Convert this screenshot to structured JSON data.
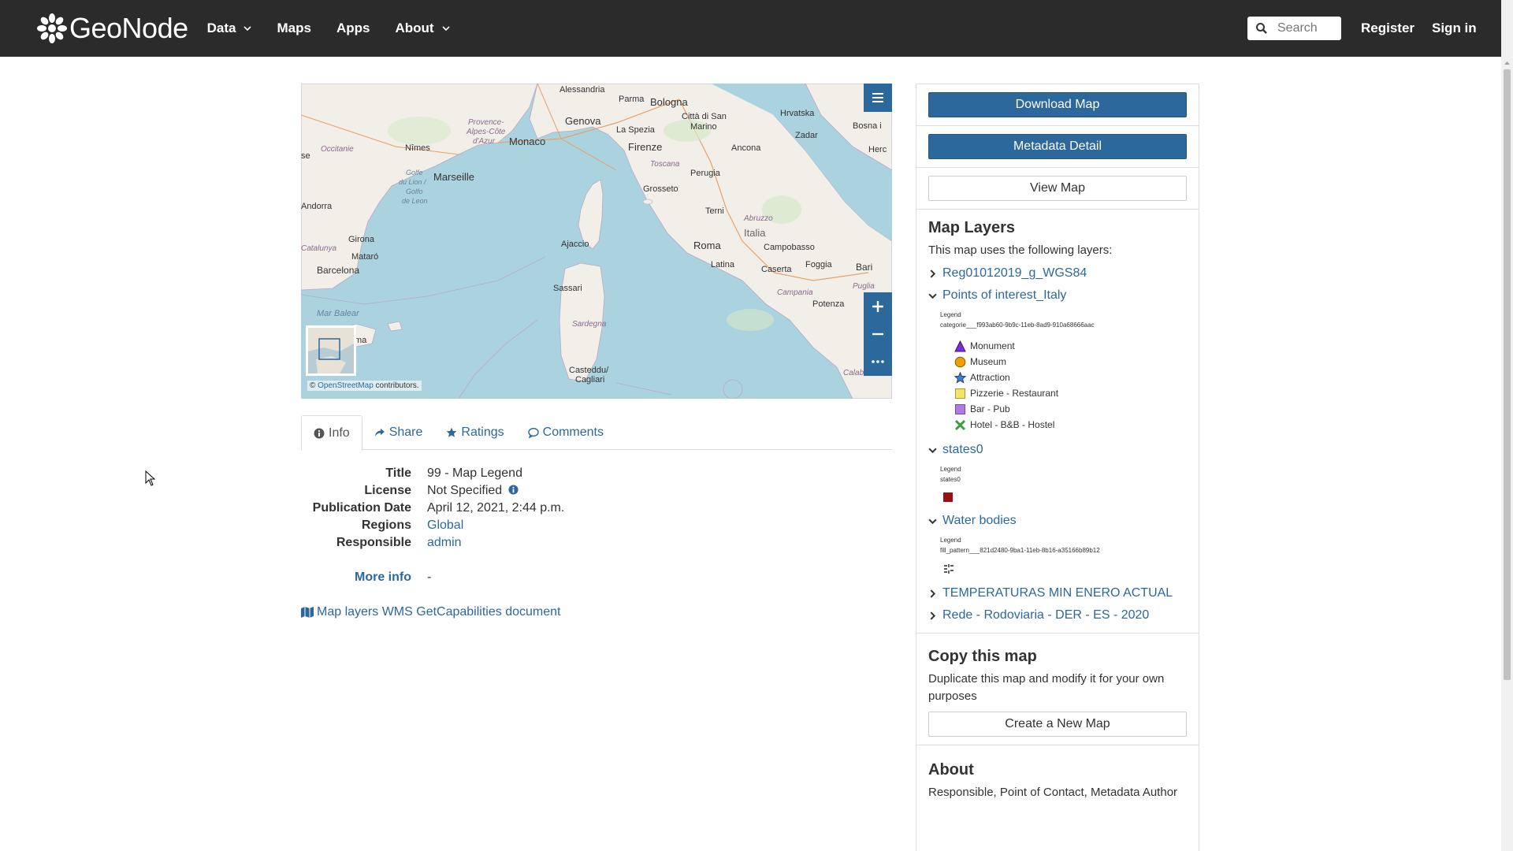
{
  "navbar": {
    "brand": "GeoNode",
    "links": [
      {
        "label": "Data",
        "dropdown": true
      },
      {
        "label": "Maps",
        "dropdown": false
      },
      {
        "label": "Apps",
        "dropdown": false
      },
      {
        "label": "About",
        "dropdown": true
      }
    ],
    "search_placeholder": "Search",
    "register": "Register",
    "signin": "Sign in"
  },
  "map": {
    "attribution_prefix": "©",
    "attribution_link": "OpenStreetMap",
    "attribution_suffix": "contributors.",
    "labels": {
      "alessandria": "Alessandria",
      "parma": "Parma",
      "bologna": "Bologna",
      "genova": "Genova",
      "sanmarino1": "Città di San",
      "sanmarino2": "Marino",
      "hrvatska": "Hrvatska",
      "bosna": "Bosna i",
      "zadar": "Zadar",
      "herc": "Herc",
      "provence1": "Provence-",
      "provence2": "Alpes-Côte",
      "provence3": "d'Azur",
      "monaco": "Monaco",
      "laspezia": "La Spezia",
      "firenze": "Firenze",
      "ancona": "Ancona",
      "nimes": "Nîmes",
      "occitanie": "Occitanie",
      "toscana": "Toscana",
      "perugia": "Perugia",
      "marseille": "Marseille",
      "golfe1": "Golfe",
      "golfe2": "du Lion /",
      "golfe3": "Golfo",
      "golfe4": "de Leon",
      "grosseto": "Grosseto",
      "andorra": "Andorra",
      "terni": "Terni",
      "abruzzo": "Abruzzo",
      "italia": "Italia",
      "girona": "Girona",
      "ajaccio": "Ajaccio",
      "roma": "Roma",
      "campobasso": "Campobasso",
      "catalunya": "Catalunya",
      "mataro": "Mataró",
      "foggia": "Foggia",
      "bari": "Bari",
      "barcelona": "Barcelona",
      "sassari": "Sassari",
      "latina": "Latina",
      "caserta": "Caserta",
      "campania": "Campania",
      "puglia": "Puglia",
      "sardegna": "Sardegna",
      "potenza": "Potenza",
      "marbalear": "Mar Balear",
      "palma": "ma",
      "cagliari1": "Casteddu/",
      "cagliari2": "Cagliari",
      "calab": "Calab",
      "se": "se"
    }
  },
  "tabs": [
    {
      "label": "Info",
      "icon": "info-circle-icon"
    },
    {
      "label": "Share",
      "icon": "share-icon"
    },
    {
      "label": "Ratings",
      "icon": "star-icon"
    },
    {
      "label": "Comments",
      "icon": "comment-icon"
    }
  ],
  "info": {
    "rows": [
      {
        "key": "Title",
        "value": "99 - Map Legend"
      },
      {
        "key": "License",
        "value": "Not Specified"
      },
      {
        "key": "Publication Date",
        "value": "April 12, 2021, 2:44 p.m."
      },
      {
        "key": "Regions",
        "value": "Global"
      },
      {
        "key": "Responsible",
        "value": "admin"
      }
    ],
    "more_info_label": "More info",
    "more_info_value": "-",
    "wms_link": "Map layers WMS GetCapabilities document"
  },
  "sidebar": {
    "download_map": "Download Map",
    "metadata_detail": "Metadata Detail",
    "view_map": "View Map",
    "map_layers_title": "Map Layers",
    "map_layers_desc": "This map uses the following layers:",
    "layers": [
      {
        "name": "Reg01012019_g_WGS84",
        "expanded": false
      },
      {
        "name": "Points of interest_Italy",
        "expanded": true,
        "legend_label": "Legend",
        "legend_id": "categorie___f993ab60-9b9c-11eb-8ad9-910a68666aac",
        "items": [
          "Monument",
          "Museum",
          "Attraction",
          "Pizzerie - Restaurant",
          "Bar - Pub",
          "Hotel - B&B - Hostel"
        ]
      },
      {
        "name": "states0",
        "expanded": true,
        "legend_label": "Legend",
        "legend_id": "states0"
      },
      {
        "name": "Water bodies",
        "expanded": true,
        "legend_label": "Legend",
        "legend_id": "fill_pattern___821d2480-9ba1-11eb-8b16-a35166b89b12"
      },
      {
        "name": "TEMPERATURAS MIN ENERO ACTUAL",
        "expanded": false
      },
      {
        "name": "Rede - Rodoviaria - DER - ES - 2020",
        "expanded": false
      }
    ],
    "copy_title": "Copy this map",
    "copy_desc": "Duplicate this map and modify it for your own purposes",
    "create_new_map": "Create a New Map",
    "about_title": "About",
    "about_desc": "Responsible, Point of Contact, Metadata Author"
  },
  "colors": {
    "navbar_bg": "#2b2b2b",
    "primary": "#2c689c",
    "sea": "#aad3df",
    "land": "#f2efe9",
    "monument": "#7b2fd6",
    "museum": "#f0a000",
    "attraction": "#3f7fd6",
    "pizzerie": "#f5e26b",
    "bar": "#b07be0",
    "hotel": "#3c9e3c",
    "states0": "#9a0f0f"
  }
}
